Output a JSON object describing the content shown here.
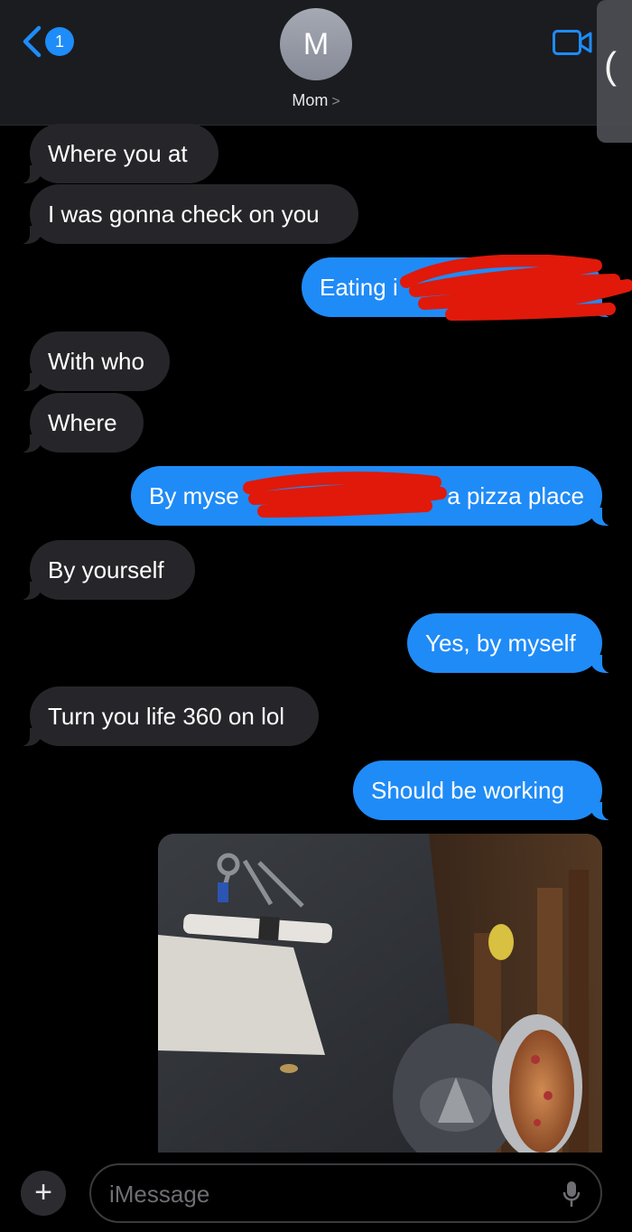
{
  "header": {
    "back_badge": "1",
    "avatar_initial": "M",
    "contact_name": "Mom",
    "contact_chevron": ">",
    "pull_tab_glyph": "("
  },
  "messages": [
    {
      "direction": "incoming",
      "text": "Where you at"
    },
    {
      "direction": "incoming",
      "text": "I was gonna check on you"
    },
    {
      "direction": "outgoing",
      "text": "Eating i",
      "redacted": true
    },
    {
      "direction": "incoming",
      "text": "With who"
    },
    {
      "direction": "incoming",
      "text": "Where"
    },
    {
      "direction": "outgoing",
      "text_before": "By myse",
      "text_after": "a pizza place",
      "redacted": true
    },
    {
      "direction": "incoming",
      "text": "By yourself"
    },
    {
      "direction": "outgoing",
      "text": "Yes, by myself"
    },
    {
      "direction": "incoming",
      "text": "Turn you life 360 on lol"
    },
    {
      "direction": "outgoing",
      "text": "Should be working"
    },
    {
      "direction": "outgoing",
      "type": "photo"
    }
  ],
  "composer": {
    "plus_label": "+",
    "placeholder": "iMessage"
  },
  "colors": {
    "incoming_bubble": "#26262a",
    "outgoing_bubble": "#1f8bf7",
    "redaction": "#e0190a",
    "header_bg": "#1b1c20"
  },
  "icons": [
    "chevron-left-icon",
    "video-camera-icon",
    "plus-icon",
    "microphone-icon"
  ]
}
